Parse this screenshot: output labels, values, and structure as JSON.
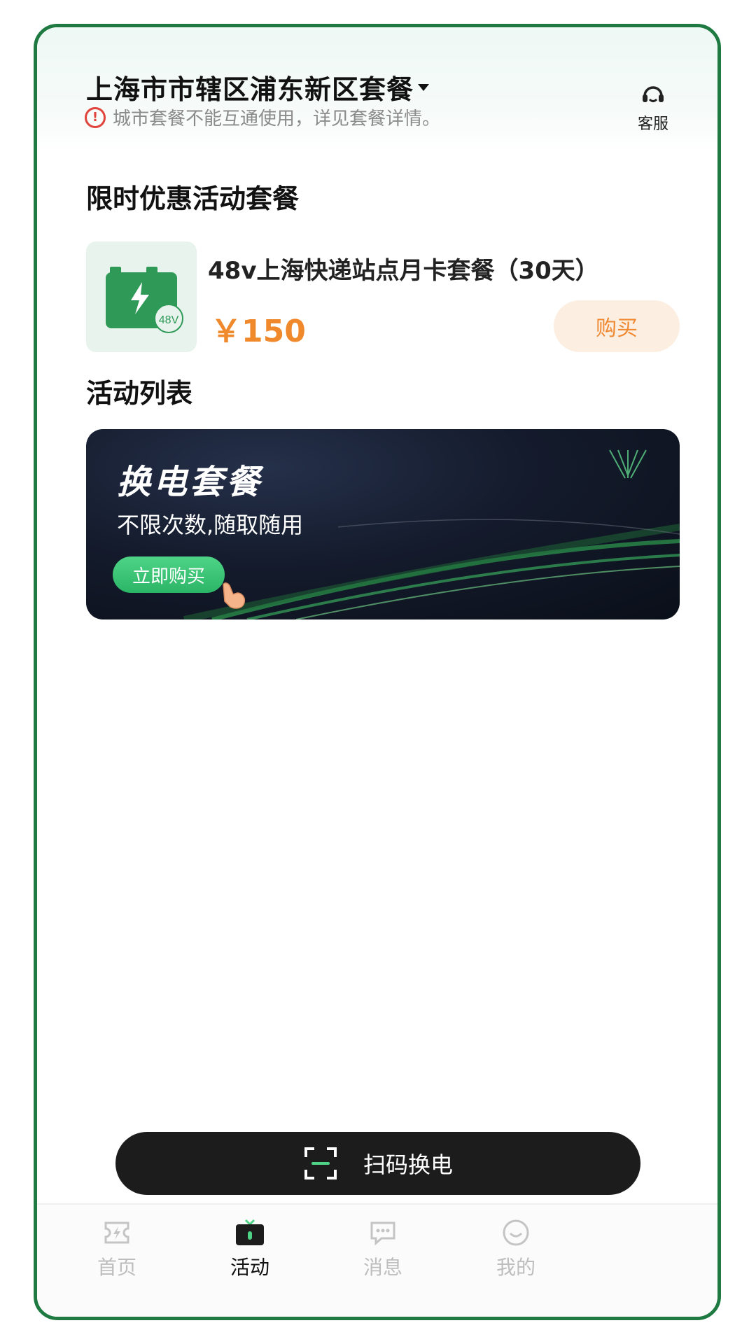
{
  "header": {
    "city_title": "上海市市辖区浦东新区套餐",
    "notice": "城市套餐不能互通使用，详见套餐详情。",
    "service_label": "客服"
  },
  "sections": {
    "promo_title": "限时优惠活动套餐",
    "activity_title": "活动列表"
  },
  "package": {
    "badge": "48V",
    "name": "48v上海快递站点月卡套餐（30天）",
    "price": "￥150",
    "buy_label": "购买"
  },
  "banner": {
    "title": "换电套餐",
    "subtitle": "不限次数,随取随用",
    "cta": "立即购买"
  },
  "scan_button": {
    "label": "扫码换电"
  },
  "tabs": [
    {
      "label": "首页",
      "icon": "ticket-icon"
    },
    {
      "label": "活动",
      "icon": "gift-box-icon"
    },
    {
      "label": "消息",
      "icon": "chat-icon"
    },
    {
      "label": "我的",
      "icon": "smile-icon"
    }
  ],
  "active_tab": "活动",
  "colors": {
    "brand_green": "#1e7a41",
    "price_orange": "#f0882c",
    "warning_red": "#e0433b",
    "scan_dark": "#1c1c1c"
  }
}
